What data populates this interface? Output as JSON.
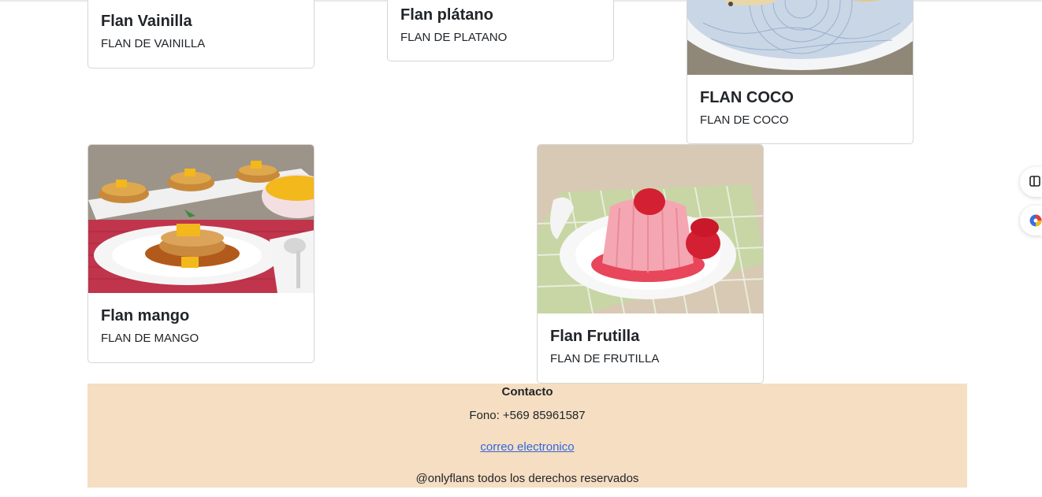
{
  "cards": [
    {
      "id": "vainilla",
      "title": "Flan Vainilla",
      "text": "FLAN DE VAINILLA"
    },
    {
      "id": "platano",
      "title": "Flan plátano",
      "text": "FLAN DE PLATANO"
    },
    {
      "id": "coco",
      "title": "FLAN COCO",
      "text": "FLAN DE COCO"
    },
    {
      "id": "mango",
      "title": "Flan mango",
      "text": "FLAN DE MANGO"
    },
    {
      "id": "frutilla",
      "title": "Flan Frutilla",
      "text": "FLAN DE FRUTILLA"
    }
  ],
  "footer": {
    "title": "Contacto",
    "phone": "Fono: +569 85961587",
    "email_link": "correo electronico",
    "copyright": "@onlyflans todos los derechos reservados"
  },
  "colors": {
    "footer_bg": "#f5dec2",
    "link": "#3366dd"
  },
  "icons": {
    "side_widget_1": "sidebar-panel-icon",
    "side_widget_2": "color-globe-icon"
  }
}
